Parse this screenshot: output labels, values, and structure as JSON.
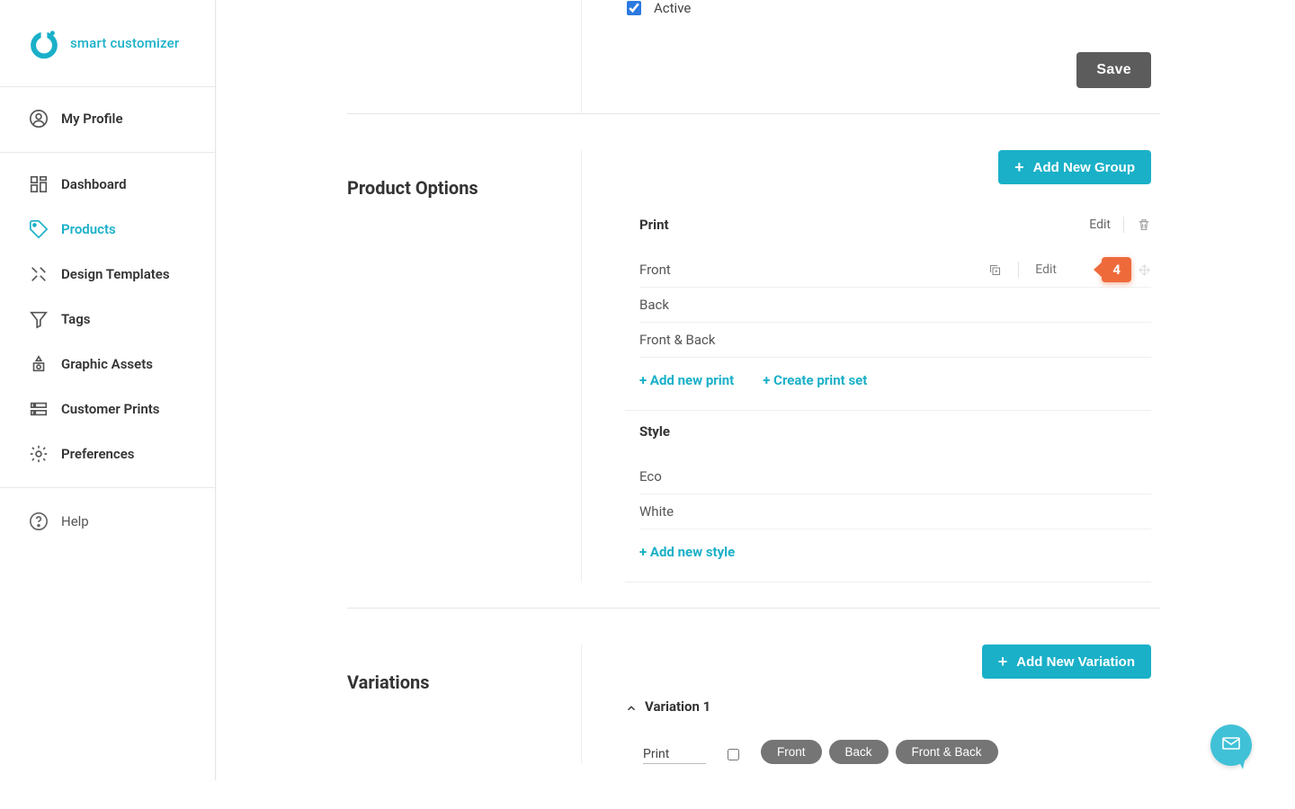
{
  "brand": {
    "name": "smart customizer"
  },
  "sidebar": {
    "profile_label": "My Profile",
    "items": [
      {
        "key": "dashboard",
        "label": "Dashboard"
      },
      {
        "key": "products",
        "label": "Products",
        "active": true
      },
      {
        "key": "design-templates",
        "label": "Design Templates"
      },
      {
        "key": "tags",
        "label": "Tags"
      },
      {
        "key": "graphic-assets",
        "label": "Graphic Assets"
      },
      {
        "key": "customer-prints",
        "label": "Customer Prints"
      },
      {
        "key": "preferences",
        "label": "Preferences"
      }
    ],
    "help_label": "Help"
  },
  "form": {
    "active_label": "Active",
    "active_checked": true,
    "save_label": "Save"
  },
  "options": {
    "title": "Product Options",
    "add_group_label": "Add New Group",
    "groups": [
      {
        "name": "Print",
        "edit_label": "Edit",
        "rows": [
          {
            "label": "Front",
            "hover": true,
            "edit_label": "Edit",
            "badge": "4"
          },
          {
            "label": "Back"
          },
          {
            "label": "Front & Back"
          }
        ],
        "add_links": [
          {
            "label": "+ Add new print"
          },
          {
            "label": "+ Create print set"
          }
        ]
      },
      {
        "name": "Style",
        "rows": [
          {
            "label": "Eco"
          },
          {
            "label": "White"
          }
        ],
        "add_links": [
          {
            "label": "+ Add new style"
          }
        ]
      }
    ]
  },
  "variations": {
    "title": "Variations",
    "add_variation_label": "Add New Variation",
    "items": [
      {
        "name": "Variation 1",
        "expanded": true,
        "attr_label": "Print",
        "pills": [
          "Front",
          "Back",
          "Front & Back"
        ]
      }
    ]
  },
  "colors": {
    "accent": "#1ab0c8",
    "callout": "#ee6a3a",
    "save_btn": "#5c5c5c"
  }
}
